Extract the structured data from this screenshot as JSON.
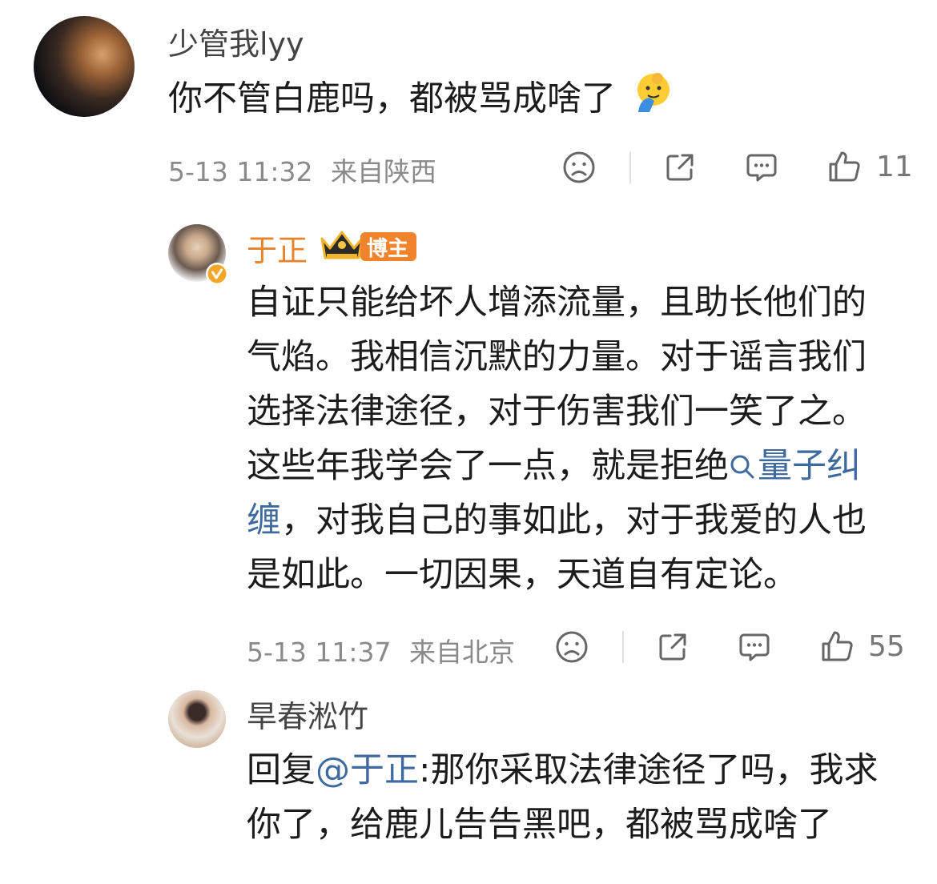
{
  "comment1": {
    "username": "少管我lyy",
    "text": "你不管白鹿吗，都被骂成啥了",
    "time": "5-13 11:32",
    "location": "来自陕西",
    "likes": "11"
  },
  "reply1": {
    "username": "于正",
    "badge": "博主",
    "text_part1": "自证只能给坏人增添流量，且助长他们的气焰。我相信沉默的力量。对于谣言我们选择法律途径，对于伤害我们一笑了之。这些年我学会了一点，就是拒绝",
    "topic_link": "量子纠缠",
    "text_part2": "，对我自己的事如此，对于我爱的人也是如此。一切因果，天道自有定论。",
    "time": "5-13 11:37",
    "location": "来自北京",
    "likes": "55"
  },
  "reply2": {
    "username": "旱春淞竹",
    "reply_prefix": "回复",
    "mention": "@于正",
    "text": ":那你采取法律途径了吗，我求你了，给鹿儿告告黑吧，都被骂成啥了"
  },
  "colors": {
    "host_name": "#e8822b",
    "badge_bg": "#f0842c",
    "link": "#3f6aa0",
    "meta": "#8a8a8a"
  }
}
